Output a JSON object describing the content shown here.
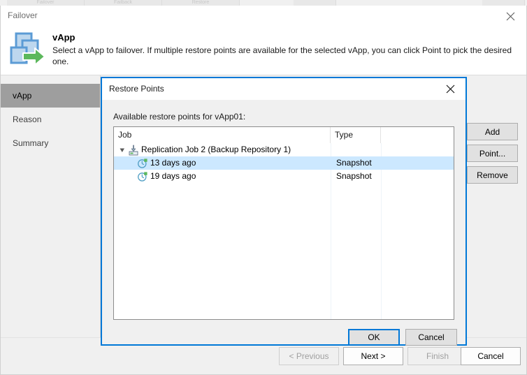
{
  "background": {
    "tabs": [
      "Failover",
      "Failback",
      "Restore"
    ]
  },
  "wizard": {
    "title": "Failover",
    "close_icon": "close-icon",
    "header": {
      "icon": "vapp-failover-icon",
      "title": "vApp",
      "description": "Select a vApp to failover. If multiple restore points are available for the selected vApp, you can click Point to pick the desired one."
    },
    "steps": [
      {
        "label": "vApp",
        "active": true
      },
      {
        "label": "Reason",
        "active": false
      },
      {
        "label": "Summary",
        "active": false
      }
    ],
    "side_buttons": [
      {
        "label": "Add",
        "name": "add-button"
      },
      {
        "label": "Point...",
        "name": "point-button"
      },
      {
        "label": "Remove",
        "name": "remove-button"
      }
    ],
    "footer_buttons": [
      {
        "label": "< Previous",
        "name": "previous-button",
        "disabled": true
      },
      {
        "label": "Next >",
        "name": "next-button",
        "disabled": false
      },
      {
        "label": "Finish",
        "name": "finish-button",
        "disabled": true
      },
      {
        "label": "Cancel",
        "name": "cancel-button",
        "disabled": false
      }
    ]
  },
  "dialog": {
    "title": "Restore Points",
    "close_icon": "close-icon",
    "label": "Available restore points for vApp01:",
    "columns": [
      "Job",
      "Type",
      ""
    ],
    "rows": [
      {
        "level": 0,
        "expander": "chevron-down-icon",
        "icon": "replication-job-icon",
        "job": "Replication Job 2 (Backup Repository 1)",
        "type": "",
        "selected": false
      },
      {
        "level": 1,
        "expander": "",
        "icon": "restore-point-clock-icon",
        "job": "13 days ago",
        "type": "Snapshot",
        "selected": true
      },
      {
        "level": 1,
        "expander": "",
        "icon": "restore-point-clock-icon",
        "job": "19 days ago",
        "type": "Snapshot",
        "selected": false
      }
    ],
    "buttons": [
      {
        "label": "OK",
        "name": "ok-button",
        "default": true
      },
      {
        "label": "Cancel",
        "name": "cancel-button",
        "default": false
      }
    ]
  },
  "colors": {
    "accent": "#0078d7",
    "selection": "#cce8ff",
    "step_active": "#9e9e9e",
    "icon_blue": "#5b9bd5",
    "icon_blue_fill": "#bdd7ee",
    "icon_green": "#5cb85c"
  }
}
